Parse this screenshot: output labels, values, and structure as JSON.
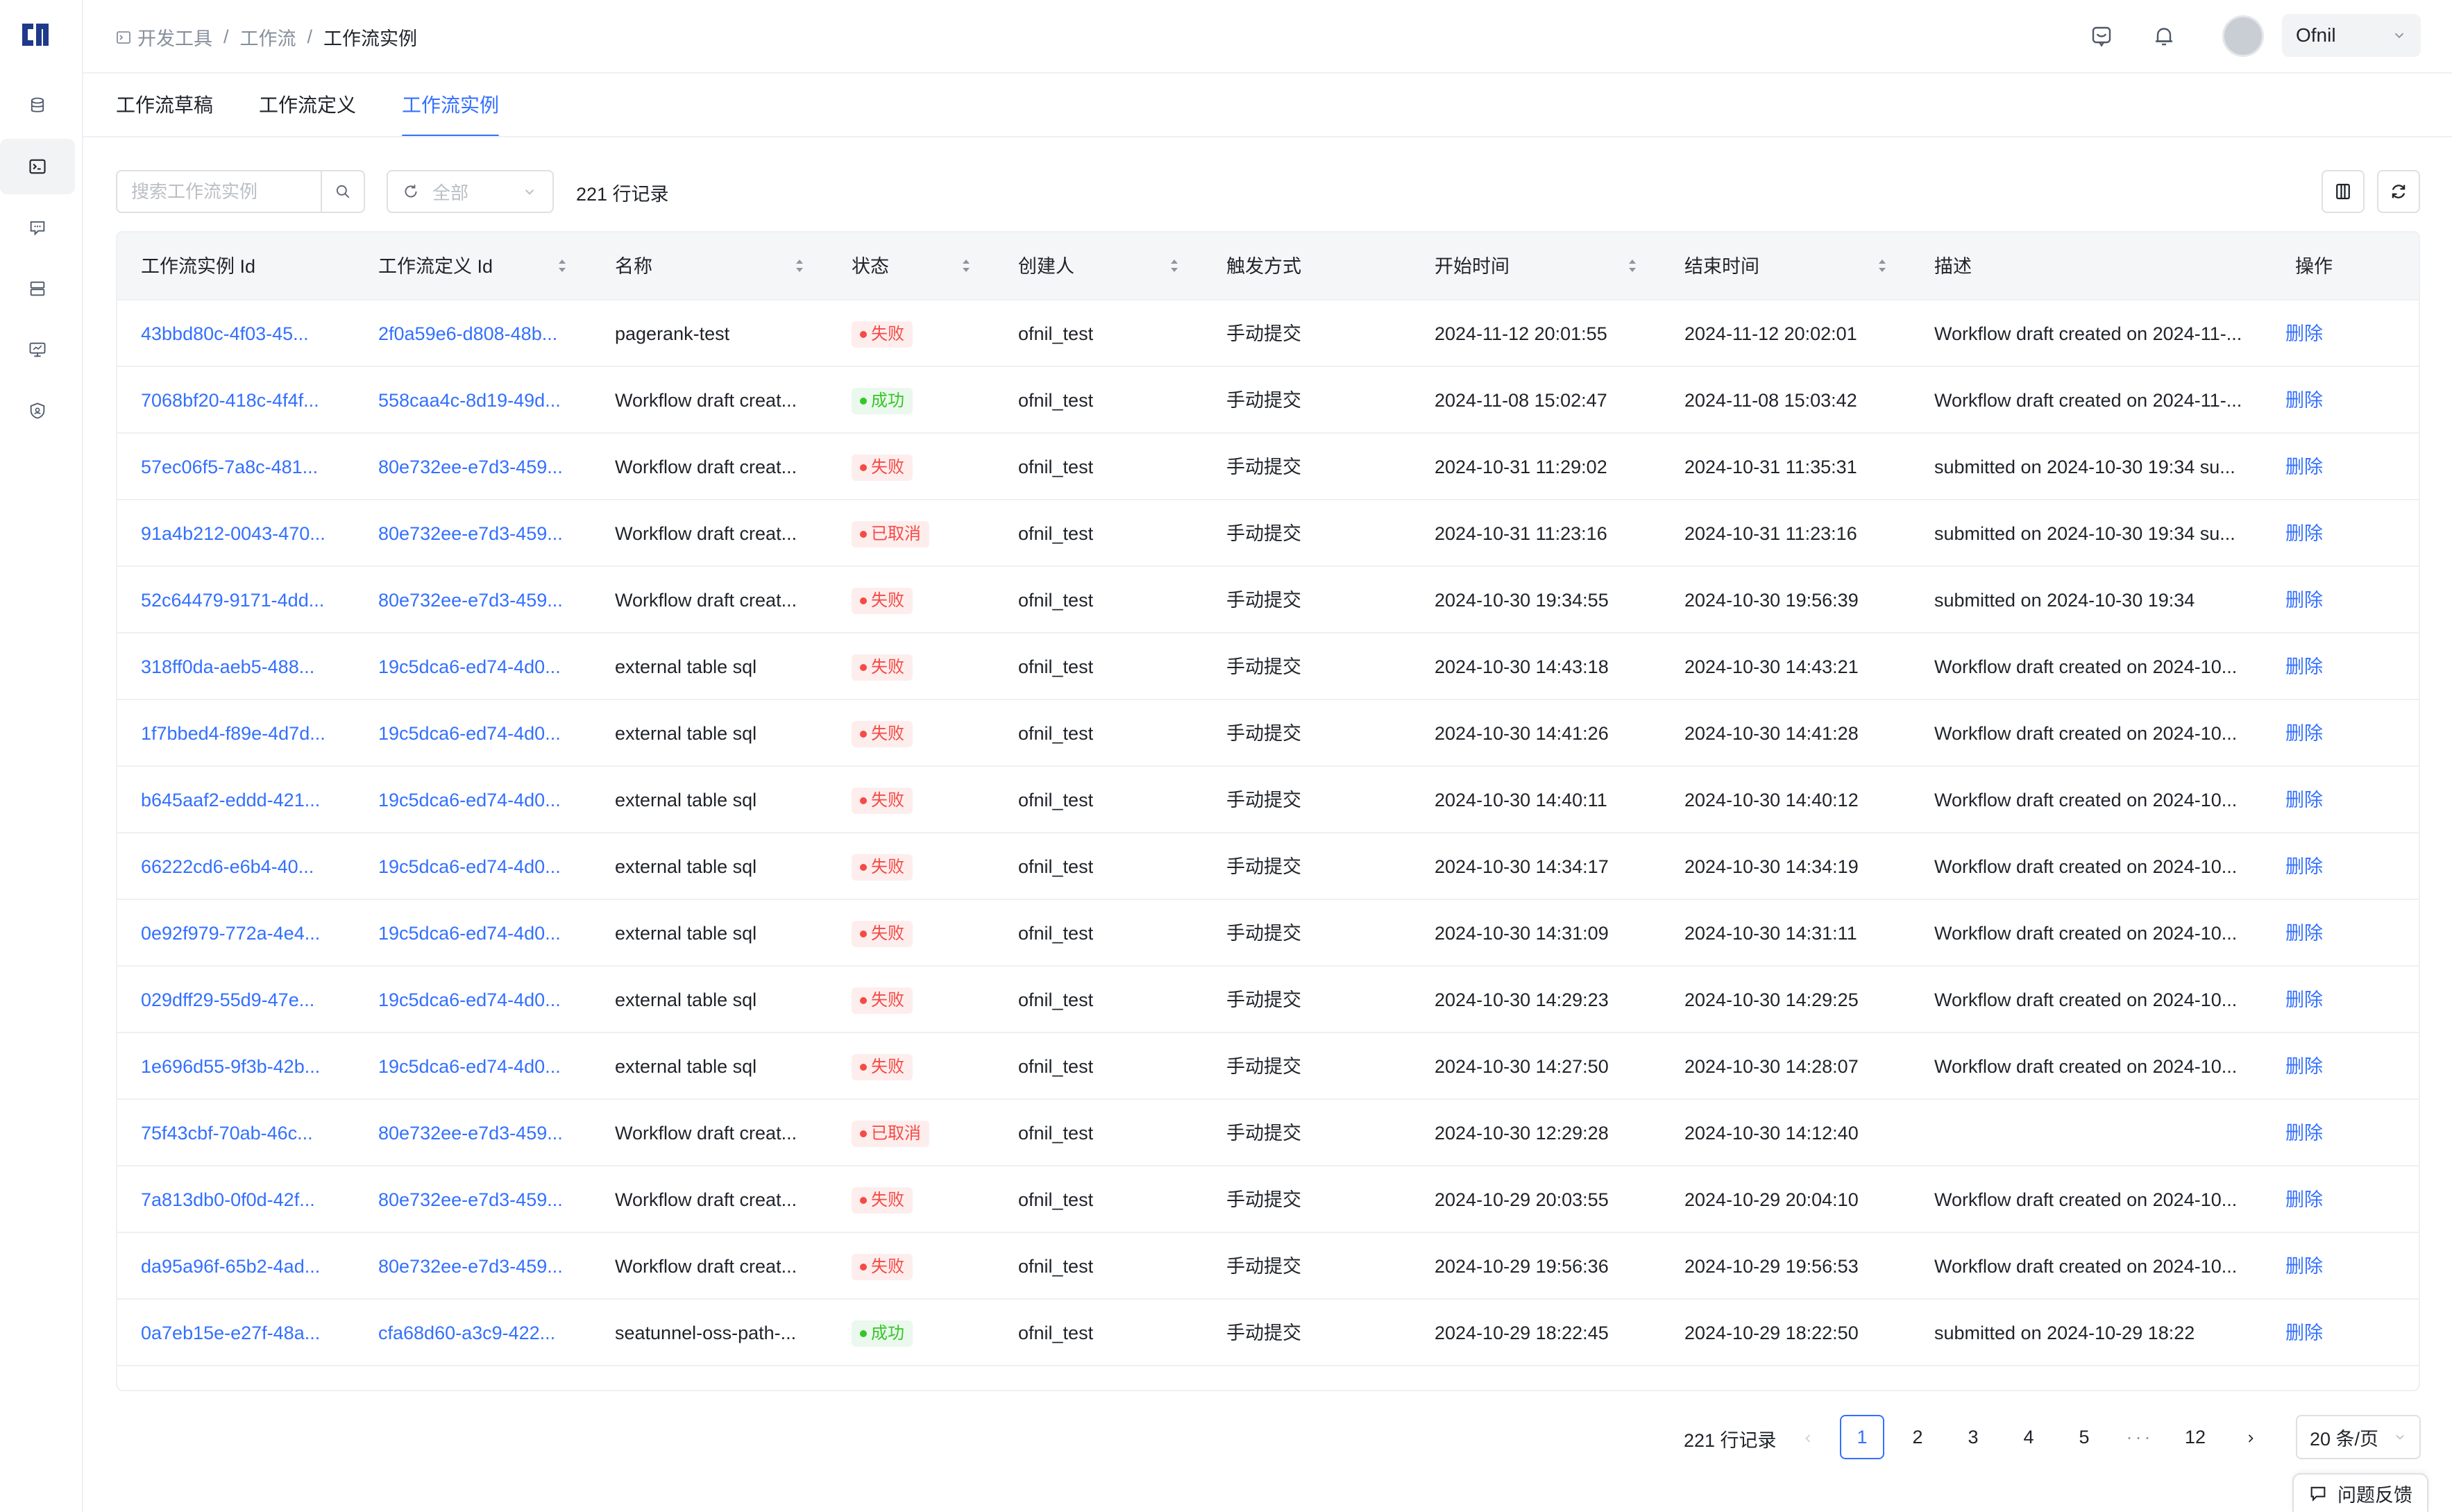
{
  "breadcrumb": [
    "开发工具",
    "工作流",
    "工作流实例"
  ],
  "user": {
    "name": "Ofnil"
  },
  "tabs": [
    {
      "label": "工作流草稿",
      "active": false
    },
    {
      "label": "工作流定义",
      "active": false
    },
    {
      "label": "工作流实例",
      "active": true
    }
  ],
  "toolbar": {
    "search_placeholder": "搜索工作流实例",
    "status_filter": "全部",
    "record_count": "221 行记录"
  },
  "table": {
    "columns": [
      "工作流实例 Id",
      "工作流定义 Id",
      "名称",
      "状态",
      "创建人",
      "触发方式",
      "开始时间",
      "结束时间",
      "描述",
      "操作"
    ],
    "rows": [
      {
        "id": "43bbd80c-4f03-45...",
        "def": "2f0a59e6-d808-48b...",
        "name": "pagerank-test",
        "status": "失败",
        "kind": "fail",
        "creator": "ofnil_test",
        "trigger": "手动提交",
        "start": "2024-11-12 20:01:55",
        "end": "2024-11-12 20:02:01",
        "desc": "Workflow draft created on 2024-11-...",
        "action": "删除"
      },
      {
        "id": "7068bf20-418c-4f4f...",
        "def": "558caa4c-8d19-49d...",
        "name": "Workflow draft creat...",
        "status": "成功",
        "kind": "success",
        "creator": "ofnil_test",
        "trigger": "手动提交",
        "start": "2024-11-08 15:02:47",
        "end": "2024-11-08 15:03:42",
        "desc": "Workflow draft created on 2024-11-...",
        "action": "删除"
      },
      {
        "id": "57ec06f5-7a8c-481...",
        "def": "80e732ee-e7d3-459...",
        "name": "Workflow draft creat...",
        "status": "失败",
        "kind": "fail",
        "creator": "ofnil_test",
        "trigger": "手动提交",
        "start": "2024-10-31 11:29:02",
        "end": "2024-10-31 11:35:31",
        "desc": "submitted on 2024-10-30 19:34 su...",
        "action": "删除"
      },
      {
        "id": "91a4b212-0043-470...",
        "def": "80e732ee-e7d3-459...",
        "name": "Workflow draft creat...",
        "status": "已取消",
        "kind": "cancel",
        "creator": "ofnil_test",
        "trigger": "手动提交",
        "start": "2024-10-31 11:23:16",
        "end": "2024-10-31 11:23:16",
        "desc": "submitted on 2024-10-30 19:34 su...",
        "action": "删除"
      },
      {
        "id": "52c64479-9171-4dd...",
        "def": "80e732ee-e7d3-459...",
        "name": "Workflow draft creat...",
        "status": "失败",
        "kind": "fail",
        "creator": "ofnil_test",
        "trigger": "手动提交",
        "start": "2024-10-30 19:34:55",
        "end": "2024-10-30 19:56:39",
        "desc": "submitted on 2024-10-30 19:34",
        "action": "删除"
      },
      {
        "id": "318ff0da-aeb5-488...",
        "def": "19c5dca6-ed74-4d0...",
        "name": "external table sql",
        "status": "失败",
        "kind": "fail",
        "creator": "ofnil_test",
        "trigger": "手动提交",
        "start": "2024-10-30 14:43:18",
        "end": "2024-10-30 14:43:21",
        "desc": "Workflow draft created on 2024-10...",
        "action": "删除"
      },
      {
        "id": "1f7bbed4-f89e-4d7d...",
        "def": "19c5dca6-ed74-4d0...",
        "name": "external table sql",
        "status": "失败",
        "kind": "fail",
        "creator": "ofnil_test",
        "trigger": "手动提交",
        "start": "2024-10-30 14:41:26",
        "end": "2024-10-30 14:41:28",
        "desc": "Workflow draft created on 2024-10...",
        "action": "删除"
      },
      {
        "id": "b645aaf2-eddd-421...",
        "def": "19c5dca6-ed74-4d0...",
        "name": "external table sql",
        "status": "失败",
        "kind": "fail",
        "creator": "ofnil_test",
        "trigger": "手动提交",
        "start": "2024-10-30 14:40:11",
        "end": "2024-10-30 14:40:12",
        "desc": "Workflow draft created on 2024-10...",
        "action": "删除"
      },
      {
        "id": "66222cd6-e6b4-40...",
        "def": "19c5dca6-ed74-4d0...",
        "name": "external table sql",
        "status": "失败",
        "kind": "fail",
        "creator": "ofnil_test",
        "trigger": "手动提交",
        "start": "2024-10-30 14:34:17",
        "end": "2024-10-30 14:34:19",
        "desc": "Workflow draft created on 2024-10...",
        "action": "删除"
      },
      {
        "id": "0e92f979-772a-4e4...",
        "def": "19c5dca6-ed74-4d0...",
        "name": "external table sql",
        "status": "失败",
        "kind": "fail",
        "creator": "ofnil_test",
        "trigger": "手动提交",
        "start": "2024-10-30 14:31:09",
        "end": "2024-10-30 14:31:11",
        "desc": "Workflow draft created on 2024-10...",
        "action": "删除"
      },
      {
        "id": "029dff29-55d9-47e...",
        "def": "19c5dca6-ed74-4d0...",
        "name": "external table sql",
        "status": "失败",
        "kind": "fail",
        "creator": "ofnil_test",
        "trigger": "手动提交",
        "start": "2024-10-30 14:29:23",
        "end": "2024-10-30 14:29:25",
        "desc": "Workflow draft created on 2024-10...",
        "action": "删除"
      },
      {
        "id": "1e696d55-9f3b-42b...",
        "def": "19c5dca6-ed74-4d0...",
        "name": "external table sql",
        "status": "失败",
        "kind": "fail",
        "creator": "ofnil_test",
        "trigger": "手动提交",
        "start": "2024-10-30 14:27:50",
        "end": "2024-10-30 14:28:07",
        "desc": "Workflow draft created on 2024-10...",
        "action": "删除"
      },
      {
        "id": "75f43cbf-70ab-46c...",
        "def": "80e732ee-e7d3-459...",
        "name": "Workflow draft creat...",
        "status": "已取消",
        "kind": "cancel",
        "creator": "ofnil_test",
        "trigger": "手动提交",
        "start": "2024-10-30 12:29:28",
        "end": "2024-10-30 14:12:40",
        "desc": "",
        "action": "删除"
      },
      {
        "id": "7a813db0-0f0d-42f...",
        "def": "80e732ee-e7d3-459...",
        "name": "Workflow draft creat...",
        "status": "失败",
        "kind": "fail",
        "creator": "ofnil_test",
        "trigger": "手动提交",
        "start": "2024-10-29 20:03:55",
        "end": "2024-10-29 20:04:10",
        "desc": "Workflow draft created on 2024-10...",
        "action": "删除"
      },
      {
        "id": "da95a96f-65b2-4ad...",
        "def": "80e732ee-e7d3-459...",
        "name": "Workflow draft creat...",
        "status": "失败",
        "kind": "fail",
        "creator": "ofnil_test",
        "trigger": "手动提交",
        "start": "2024-10-29 19:56:36",
        "end": "2024-10-29 19:56:53",
        "desc": "Workflow draft created on 2024-10...",
        "action": "删除"
      },
      {
        "id": "0a7eb15e-e27f-48a...",
        "def": "cfa68d60-a3c9-422...",
        "name": "seatunnel-oss-path-...",
        "status": "成功",
        "kind": "success",
        "creator": "ofnil_test",
        "trigger": "手动提交",
        "start": "2024-10-29 18:22:45",
        "end": "2024-10-29 18:22:50",
        "desc": "submitted on 2024-10-29 18:22",
        "action": "删除"
      }
    ]
  },
  "pagination": {
    "total": "221 行记录",
    "pages": [
      "1",
      "2",
      "3",
      "4",
      "5",
      "12"
    ],
    "current": "1",
    "page_size": "20 条/页"
  },
  "feedback_label": "问题反馈",
  "colors": {
    "accent": "#3370ff",
    "fail": "#f54a45",
    "success": "#34c724"
  }
}
